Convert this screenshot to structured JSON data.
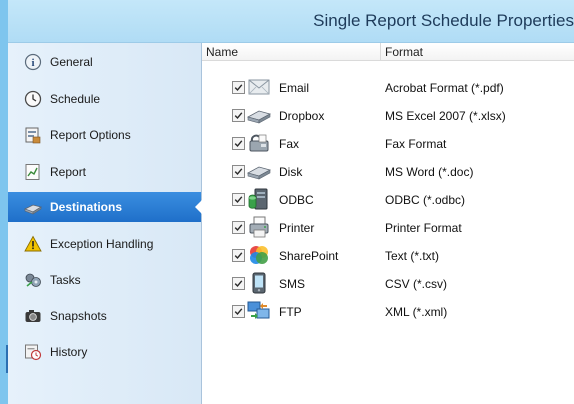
{
  "window": {
    "title": "Single Report Schedule Properties"
  },
  "sidebar": {
    "items": [
      {
        "label": "General",
        "icon": "info-icon"
      },
      {
        "label": "Schedule",
        "icon": "clock-icon"
      },
      {
        "label": "Report Options",
        "icon": "report-options-icon"
      },
      {
        "label": "Report",
        "icon": "report-icon"
      },
      {
        "label": "Destinations",
        "icon": "destinations-icon",
        "active": true
      },
      {
        "label": "Exception Handling",
        "icon": "warning-icon"
      },
      {
        "label": "Tasks",
        "icon": "tasks-icon"
      },
      {
        "label": "Snapshots",
        "icon": "camera-icon"
      },
      {
        "label": "History",
        "icon": "history-icon"
      }
    ]
  },
  "table": {
    "columns": [
      "Name",
      "Format"
    ],
    "rows": [
      {
        "name": "Email",
        "format": "Acrobat Format (*.pdf)",
        "checked": true,
        "icon": "email-icon"
      },
      {
        "name": "Dropbox",
        "format": "MS Excel 2007 (*.xlsx)",
        "checked": true,
        "icon": "dropbox-icon"
      },
      {
        "name": "Fax",
        "format": "Fax Format",
        "checked": true,
        "icon": "fax-icon"
      },
      {
        "name": "Disk",
        "format": "MS Word (*.doc)",
        "checked": true,
        "icon": "disk-icon"
      },
      {
        "name": "ODBC",
        "format": "ODBC (*.odbc)",
        "checked": true,
        "icon": "odbc-icon"
      },
      {
        "name": "Printer",
        "format": "Printer Format",
        "checked": true,
        "icon": "printer-icon"
      },
      {
        "name": "SharePoint",
        "format": "Text (*.txt)",
        "checked": true,
        "icon": "sharepoint-icon"
      },
      {
        "name": "SMS",
        "format": "CSV (*.csv)",
        "checked": true,
        "icon": "sms-icon"
      },
      {
        "name": "FTP",
        "format": "XML (*.xml)",
        "checked": true,
        "icon": "ftp-icon"
      }
    ]
  },
  "colors": {
    "accent": "#1f6fc9",
    "title_bar": "#b8e0f7",
    "sidebar": "#dfecf8"
  }
}
